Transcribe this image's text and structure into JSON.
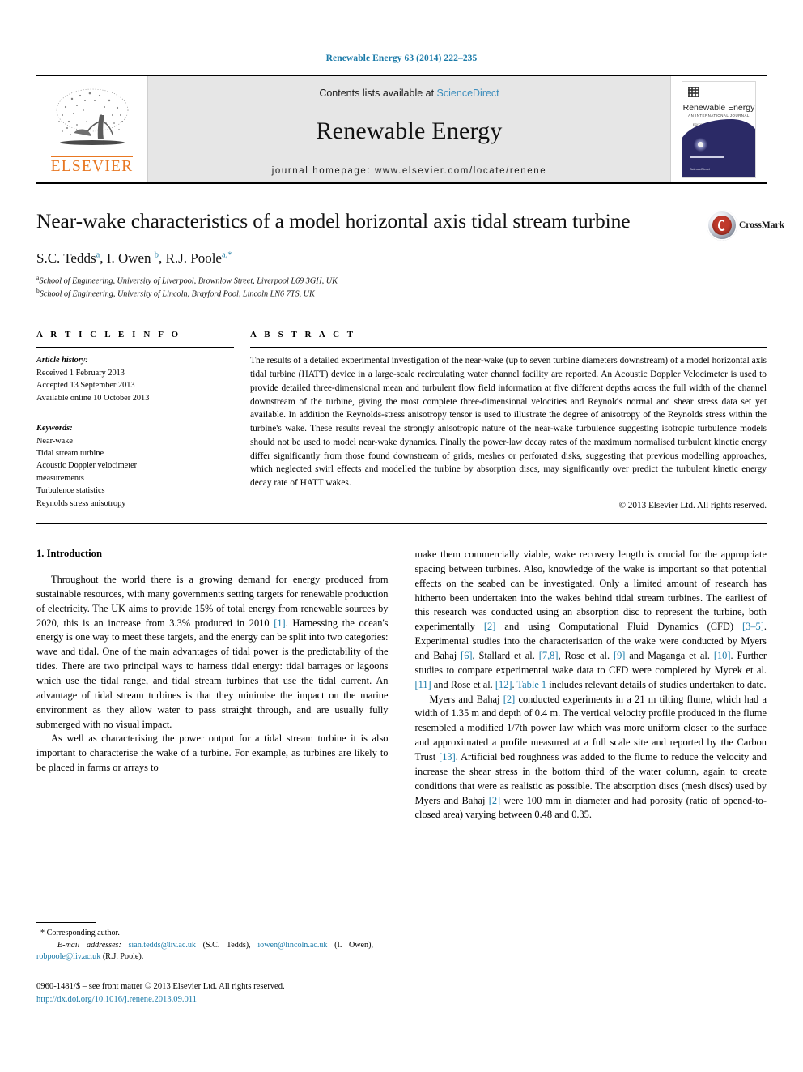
{
  "running_head": "Renewable Energy 63 (2014) 222–235",
  "masthead": {
    "publisher_name": "ELSEVIER",
    "contents_prefix": "Contents lists available at ",
    "contents_link": "ScienceDirect",
    "journal_name": "Renewable Energy",
    "homepage": "journal homepage: www.elsevier.com/locate/renene",
    "cover": {
      "title": "Renewable Energy",
      "subtitle": "AN INTERNATIONAL JOURNAL",
      "subtitle2": "EDITOR: SOTERIS A. KALOGIROU",
      "footer": "ScienceDirect"
    }
  },
  "article": {
    "title": "Near-wake characteristics of a model horizontal axis tidal stream turbine",
    "crossmark_label": "CrossMark",
    "authors_html": "S.C. Tedds <sup>a</sup>, I. Owen <sup>b</sup>, R.J. Poole <sup>a,*</sup>",
    "affiliations": [
      "School of Engineering, University of Liverpool, Brownlow Street, Liverpool L69 3GH, UK",
      "School of Engineering, University of Lincoln, Brayford Pool, Lincoln LN6 7TS, UK"
    ],
    "affiliation_marks": [
      "a",
      "b"
    ]
  },
  "article_info": {
    "heading": "A R T I C L E   I N F O",
    "history_label": "Article history:",
    "history": [
      "Received 1 February 2013",
      "Accepted 13 September 2013",
      "Available online 10 October 2013"
    ],
    "keywords_label": "Keywords:",
    "keywords": [
      "Near-wake",
      "Tidal stream turbine",
      "Acoustic Doppler velocimeter",
      "measurements",
      "Turbulence statistics",
      "Reynolds stress anisotropy"
    ]
  },
  "abstract": {
    "heading": "A B S T R A C T",
    "text": "The results of a detailed experimental investigation of the near-wake (up to seven turbine diameters downstream) of a model horizontal axis tidal turbine (HATT) device in a large-scale recirculating water channel facility are reported. An Acoustic Doppler Velocimeter is used to provide detailed three-dimensional mean and turbulent flow field information at five different depths across the full width of the channel downstream of the turbine, giving the most complete three-dimensional velocities and Reynolds normal and shear stress data set yet available. In addition the Reynolds-stress anisotropy tensor is used to illustrate the degree of anisotropy of the Reynolds stress within the turbine's wake. These results reveal the strongly anisotropic nature of the near-wake turbulence suggesting isotropic turbulence models should not be used to model near-wake dynamics. Finally the power-law decay rates of the maximum normalised turbulent kinetic energy differ significantly from those found downstream of grids, meshes or perforated disks, suggesting that previous modelling approaches, which neglected swirl effects and modelled the turbine by absorption discs, may significantly over predict the turbulent kinetic energy decay rate of HATT wakes.",
    "copyright": "© 2013 Elsevier Ltd. All rights reserved."
  },
  "introduction": {
    "section_number_title": "1. Introduction",
    "left_paragraphs": [
      "Throughout the world there is a growing demand for energy produced from sustainable resources, with many governments setting targets for renewable production of electricity. The UK aims to provide 15% of total energy from renewable sources by 2020, this is an increase from 3.3% produced in 2010 [1]. Harnessing the ocean's energy is one way to meet these targets, and the energy can be split into two categories: wave and tidal. One of the main advantages of tidal power is the predictability of the tides. There are two principal ways to harness tidal energy: tidal barrages or lagoons which use the tidal range, and tidal stream turbines that use the tidal current. An advantage of tidal stream turbines is that they minimise the impact on the marine environment as they allow water to pass straight through, and are usually fully submerged with no visual impact.",
      "As well as characterising the power output for a tidal stream turbine it is also important to characterise the wake of a turbine. For example, as turbines are likely to be placed in farms or arrays to"
    ],
    "right_paragraphs": [
      "make them commercially viable, wake recovery length is crucial for the appropriate spacing between turbines. Also, knowledge of the wake is important so that potential effects on the seabed can be investigated. Only a limited amount of research has hitherto been undertaken into the wakes behind tidal stream turbines. The earliest of this research was conducted using an absorption disc to represent the turbine, both experimentally [2] and using Computational Fluid Dynamics (CFD) [3–5]. Experimental studies into the characterisation of the wake were conducted by Myers and Bahaj [6], Stallard et al. [7,8], Rose et al. [9] and Maganga et al. [10]. Further studies to compare experimental wake data to CFD were completed by Mycek et al. [11] and Rose et al. [12]. Table 1 includes relevant details of studies undertaken to date.",
      "Myers and Bahaj [2] conducted experiments in a 21 m tilting flume, which had a width of 1.35 m and depth of 0.4 m. The vertical velocity profile produced in the flume resembled a modified 1/7th power law which was more uniform closer to the surface and approximated a profile measured at a full scale site and reported by the Carbon Trust [13]. Artificial bed roughness was added to the flume to reduce the velocity and increase the shear stress in the bottom third of the water column, again to create conditions that were as realistic as possible. The absorption discs (mesh discs) used by Myers and Bahaj [2] were 100 mm in diameter and had porosity (ratio of opened-to-closed area) varying between 0.48 and 0.35."
    ]
  },
  "footnote": {
    "corresponding": "* Corresponding author.",
    "email_label": "E-mail addresses:",
    "emails": [
      {
        "address": "sian.tedds@liv.ac.uk",
        "owner": "(S.C. Tedds)"
      },
      {
        "address": "iowen@lincoln.ac.uk",
        "owner": "(I. Owen)"
      },
      {
        "address": "robpoole@liv.ac.uk",
        "owner": "(R.J. Poole)"
      }
    ]
  },
  "footer": {
    "issn_line": "0960-1481/$ – see front matter © 2013 Elsevier Ltd. All rights reserved.",
    "doi": "http://dx.doi.org/10.1016/j.renene.2013.09.011"
  },
  "colors": {
    "link_blue": "#1a7aa8",
    "sciencedirect_blue": "#3c8dbc",
    "elsevier_orange": "#E87722",
    "masthead_grey": "#e6e6e6"
  }
}
